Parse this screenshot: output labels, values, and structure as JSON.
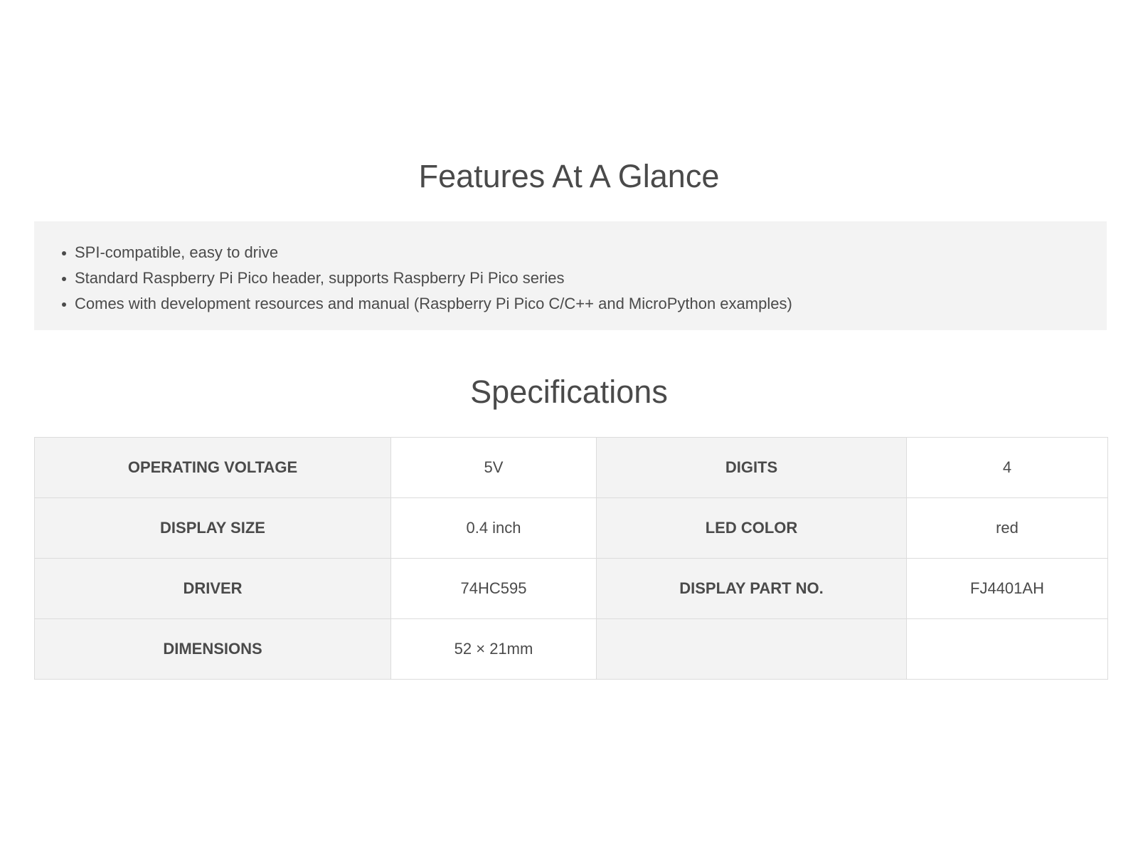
{
  "features": {
    "title": "Features At A Glance",
    "items": [
      "SPI-compatible, easy to drive",
      "Standard Raspberry Pi Pico header, supports Raspberry Pi Pico series",
      "Comes with development resources and manual (Raspberry Pi Pico C/C++ and MicroPython examples)"
    ]
  },
  "specs": {
    "title": "Specifications",
    "rows": [
      [
        "OPERATING VOLTAGE",
        "5V",
        "DIGITS",
        "4"
      ],
      [
        "DISPLAY SIZE",
        "0.4 inch",
        "LED COLOR",
        "red"
      ],
      [
        "DRIVER",
        "74HC595",
        "DISPLAY PART NO.",
        "FJ4401AH"
      ],
      [
        "DIMENSIONS",
        "52 × 21mm",
        "",
        ""
      ]
    ]
  },
  "colors": {
    "text": "#4a4a4a",
    "panel_bg": "#f3f3f3",
    "border": "#dcdcdc"
  }
}
